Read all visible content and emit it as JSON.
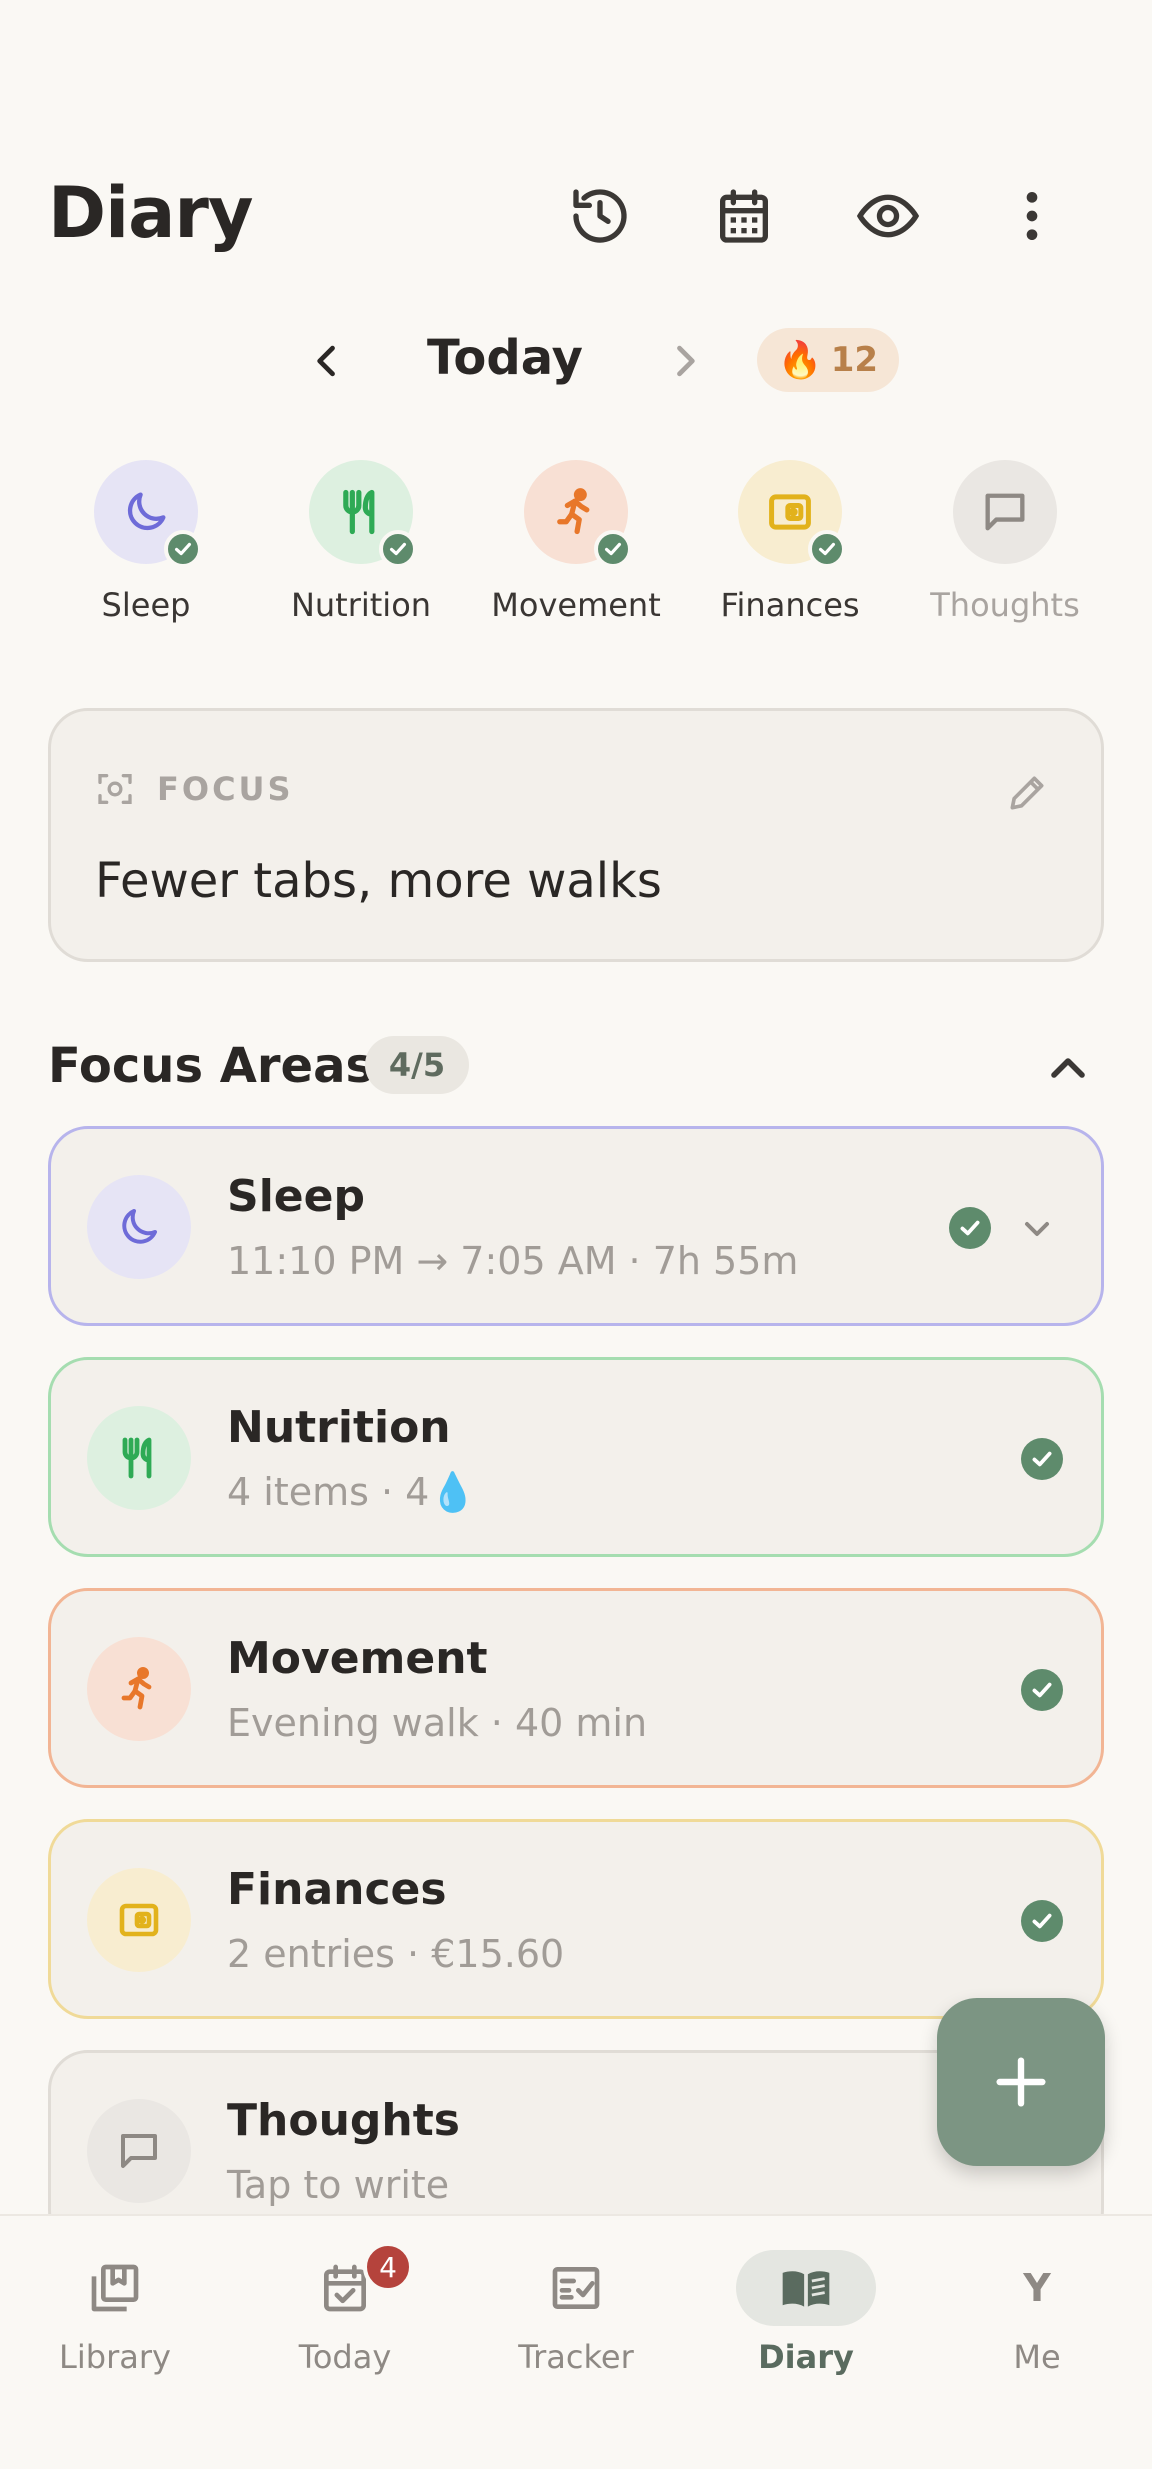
{
  "header": {
    "title": "Diary",
    "icons": [
      "history-icon",
      "calendar-icon",
      "eye-icon",
      "more-vertical-icon"
    ]
  },
  "date_nav": {
    "label": "Today",
    "streak_emoji": "🔥",
    "streak_count": "12"
  },
  "categories": [
    {
      "label": "Sleep",
      "done": true,
      "color": "#6E6BD8",
      "bg": "#E6E4F5"
    },
    {
      "label": "Nutrition",
      "done": true,
      "color": "#2EAA55",
      "bg": "#DDF0E0"
    },
    {
      "label": "Movement",
      "done": true,
      "color": "#E8772A",
      "bg": "#F8E0D4"
    },
    {
      "label": "Finances",
      "done": true,
      "color": "#E2B21C",
      "bg": "#F8EDD0"
    },
    {
      "label": "Thoughts",
      "done": false,
      "color": "#8E8984",
      "bg": "#EAE7E3"
    }
  ],
  "focus": {
    "heading": "FOCUS",
    "text": "Fewer tabs, more walks"
  },
  "focus_areas": {
    "title": "Focus Areas",
    "badge": "4/5",
    "items": [
      {
        "title": "Sleep",
        "subtitle": "11:10 PM → 7:05 AM · 7h 55m",
        "border": "#B7B4EC"
      },
      {
        "title": "Nutrition",
        "subtitle": "4 items · 4💧",
        "border": "#A5DDB0"
      },
      {
        "title": "Movement",
        "subtitle": "Evening walk · 40 min",
        "border": "#F2B594"
      },
      {
        "title": "Finances",
        "subtitle": "2 entries · €15.60",
        "border": "#F0DA98"
      },
      {
        "title": "Thoughts",
        "subtitle": "Tap to write",
        "border": "#E0DCD6"
      }
    ]
  },
  "bottom_nav": {
    "items": [
      {
        "label": "Library"
      },
      {
        "label": "Today",
        "badge": "4"
      },
      {
        "label": "Tracker"
      },
      {
        "label": "Diary",
        "active": true
      },
      {
        "label": "Me",
        "avatar": "Y"
      }
    ]
  }
}
